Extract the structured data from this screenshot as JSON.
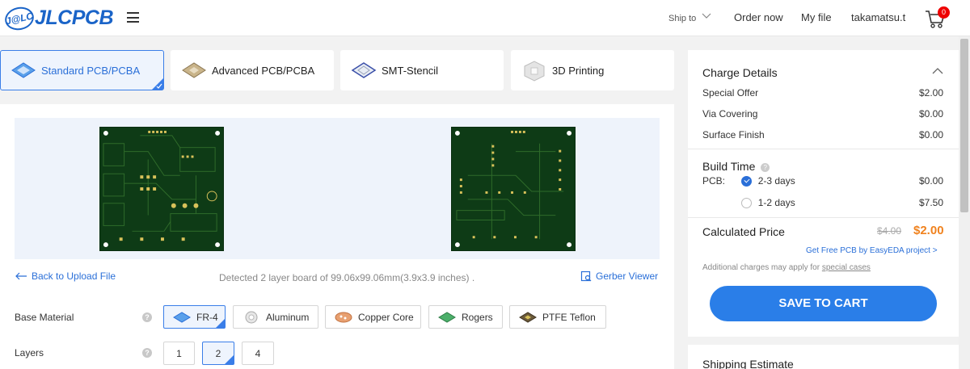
{
  "header": {
    "logo_badge": "J@LC",
    "logo_text": "JLCPCB",
    "ship_to": "Ship to",
    "order_now": "Order now",
    "my_file": "My file",
    "username": "takamatsu.t",
    "cart_count": "0"
  },
  "tabs": [
    {
      "label": "Standard PCB/PCBA",
      "active": true
    },
    {
      "label": "Advanced PCB/PCBA",
      "active": false
    },
    {
      "label": "SMT-Stencil",
      "active": false
    },
    {
      "label": "3D Printing",
      "active": false
    }
  ],
  "main": {
    "back_link": "Back to Upload File",
    "detected": "Detected 2 layer board of 99.06x99.06mm(3.9x3.9 inches) .",
    "gerber_viewer": "Gerber Viewer",
    "base_material_label": "Base Material",
    "base_materials": [
      {
        "label": "FR-4",
        "selected": true
      },
      {
        "label": "Aluminum",
        "selected": false
      },
      {
        "label": "Copper Core",
        "selected": false
      },
      {
        "label": "Rogers",
        "selected": false
      },
      {
        "label": "PTFE Teflon",
        "selected": false
      }
    ],
    "layers_label": "Layers",
    "layers": [
      {
        "label": "1",
        "selected": false
      },
      {
        "label": "2",
        "selected": true
      },
      {
        "label": "4",
        "selected": false
      }
    ]
  },
  "charge": {
    "title": "Charge Details",
    "rows": [
      {
        "label": "Special Offer",
        "value": "$2.00"
      },
      {
        "label": "Via Covering",
        "value": "$0.00"
      },
      {
        "label": "Surface Finish",
        "value": "$0.00"
      }
    ],
    "build_time_title": "Build Time",
    "pcb_label": "PCB:",
    "build_options": [
      {
        "label": "2-3 days",
        "value": "$0.00",
        "selected": true
      },
      {
        "label": "1-2 days",
        "value": "$7.50",
        "selected": false
      }
    ],
    "calculated_price_label": "Calculated Price",
    "old_price": "$4.00",
    "new_price": "$2.00",
    "free_pcb_link": "Get Free PCB by EasyEDA project >",
    "additional_note": "Additional charges may apply for",
    "special_cases": "special cases",
    "save_button": "SAVE TO CART"
  },
  "shipping": {
    "title": "Shipping Estimate"
  },
  "colors": {
    "accent": "#2a7ee8",
    "brand": "#1a64c8",
    "price": "#f0821e",
    "board": "#0e3b16"
  }
}
